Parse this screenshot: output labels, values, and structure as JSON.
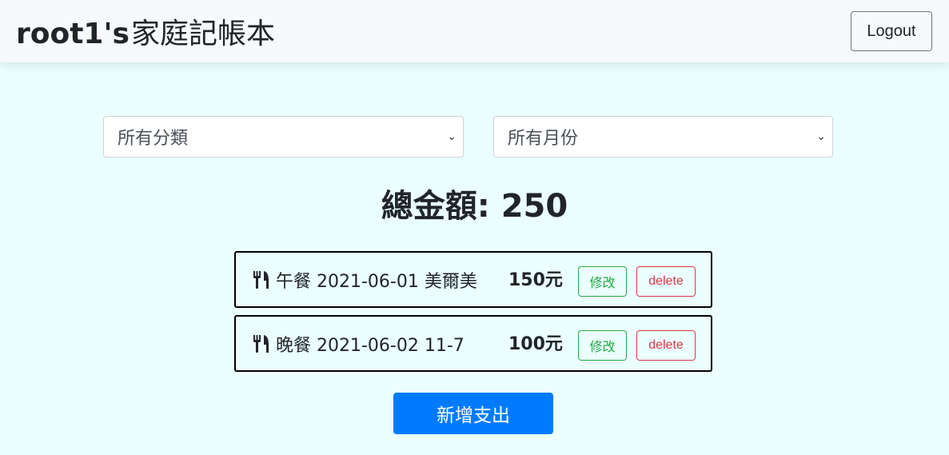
{
  "navbar": {
    "user": "root1's",
    "title": "家庭記帳本",
    "logout_label": "Logout"
  },
  "filters": {
    "category_value": "所有分類",
    "month_value": "所有月份"
  },
  "total": {
    "text": "總金額: 250"
  },
  "records": [
    {
      "icon": "utensils-icon",
      "text": "午餐 2021-06-01 美爾美",
      "amount": "150元",
      "edit_label": "修改",
      "delete_label": "delete"
    },
    {
      "icon": "utensils-icon",
      "text": "晚餐 2021-06-02 11-7",
      "amount": "100元",
      "edit_label": "修改",
      "delete_label": "delete"
    }
  ],
  "add_button_label": "新增支出",
  "colors": {
    "background": "#eafffe",
    "primary": "#007bff",
    "success": "#28a745",
    "danger": "#dc3545"
  }
}
